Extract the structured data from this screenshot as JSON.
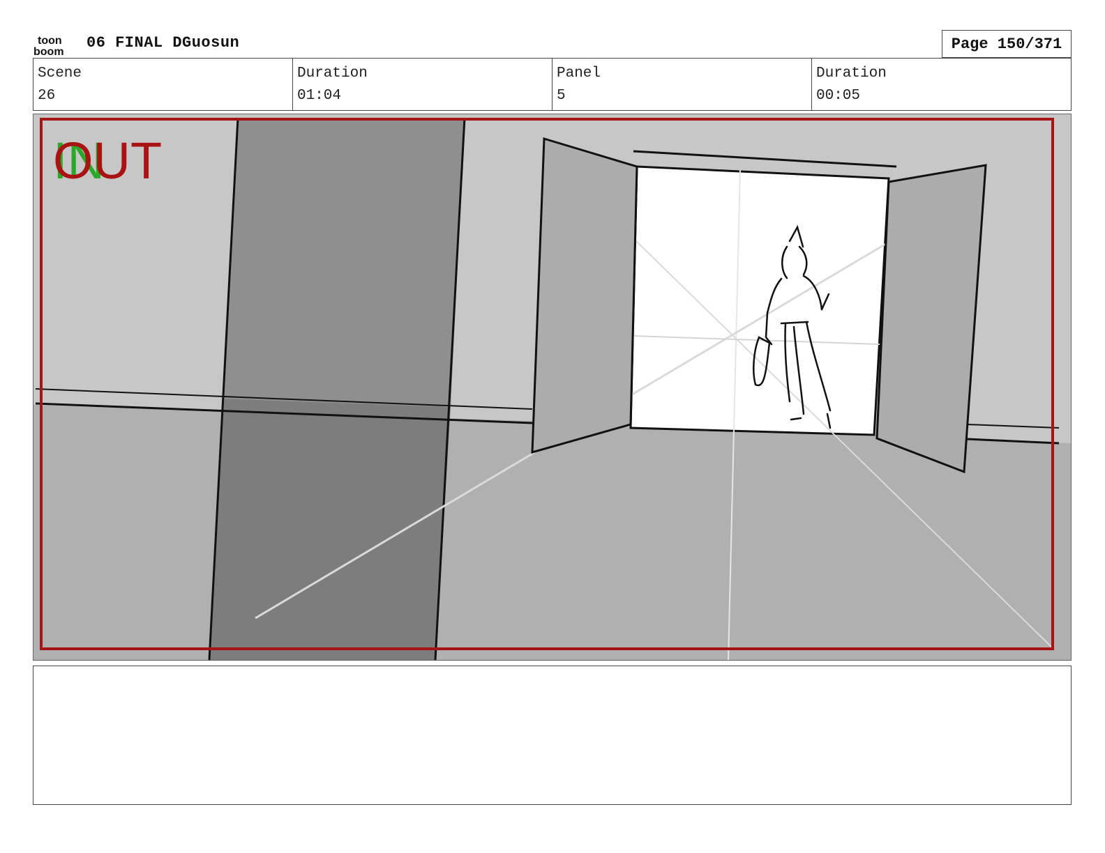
{
  "header": {
    "logo_top": "toon",
    "logo_bottom": "boom",
    "title": "06 FINAL DGuosun",
    "page": "Page 150/371"
  },
  "info": {
    "scene_label": "Scene",
    "scene_value": "26",
    "scene_duration_label": "Duration",
    "scene_duration_value": "01:04",
    "panel_label": "Panel",
    "panel_value": "5",
    "panel_duration_label": "Duration",
    "panel_duration_value": "00:05"
  },
  "panel": {
    "in_label": "IN",
    "out_label": "OUT",
    "frame_color": "#a81414",
    "in_color": "#2aa82a"
  },
  "notes": {}
}
